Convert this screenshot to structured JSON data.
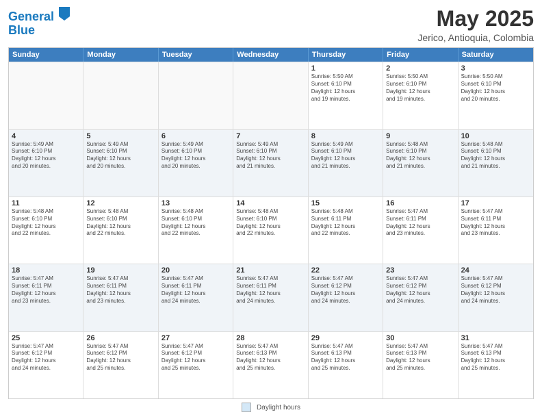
{
  "header": {
    "logo_line1": "General",
    "logo_line2": "Blue",
    "title": "May 2025",
    "subtitle": "Jerico, Antioquia, Colombia"
  },
  "days_of_week": [
    "Sunday",
    "Monday",
    "Tuesday",
    "Wednesday",
    "Thursday",
    "Friday",
    "Saturday"
  ],
  "footer": {
    "legend_label": "Daylight hours"
  },
  "weeks": [
    [
      {
        "day": "",
        "info": ""
      },
      {
        "day": "",
        "info": ""
      },
      {
        "day": "",
        "info": ""
      },
      {
        "day": "",
        "info": ""
      },
      {
        "day": "1",
        "info": "Sunrise: 5:50 AM\nSunset: 6:10 PM\nDaylight: 12 hours\nand 19 minutes."
      },
      {
        "day": "2",
        "info": "Sunrise: 5:50 AM\nSunset: 6:10 PM\nDaylight: 12 hours\nand 19 minutes."
      },
      {
        "day": "3",
        "info": "Sunrise: 5:50 AM\nSunset: 6:10 PM\nDaylight: 12 hours\nand 20 minutes."
      }
    ],
    [
      {
        "day": "4",
        "info": "Sunrise: 5:49 AM\nSunset: 6:10 PM\nDaylight: 12 hours\nand 20 minutes."
      },
      {
        "day": "5",
        "info": "Sunrise: 5:49 AM\nSunset: 6:10 PM\nDaylight: 12 hours\nand 20 minutes."
      },
      {
        "day": "6",
        "info": "Sunrise: 5:49 AM\nSunset: 6:10 PM\nDaylight: 12 hours\nand 20 minutes."
      },
      {
        "day": "7",
        "info": "Sunrise: 5:49 AM\nSunset: 6:10 PM\nDaylight: 12 hours\nand 21 minutes."
      },
      {
        "day": "8",
        "info": "Sunrise: 5:49 AM\nSunset: 6:10 PM\nDaylight: 12 hours\nand 21 minutes."
      },
      {
        "day": "9",
        "info": "Sunrise: 5:48 AM\nSunset: 6:10 PM\nDaylight: 12 hours\nand 21 minutes."
      },
      {
        "day": "10",
        "info": "Sunrise: 5:48 AM\nSunset: 6:10 PM\nDaylight: 12 hours\nand 21 minutes."
      }
    ],
    [
      {
        "day": "11",
        "info": "Sunrise: 5:48 AM\nSunset: 6:10 PM\nDaylight: 12 hours\nand 22 minutes."
      },
      {
        "day": "12",
        "info": "Sunrise: 5:48 AM\nSunset: 6:10 PM\nDaylight: 12 hours\nand 22 minutes."
      },
      {
        "day": "13",
        "info": "Sunrise: 5:48 AM\nSunset: 6:10 PM\nDaylight: 12 hours\nand 22 minutes."
      },
      {
        "day": "14",
        "info": "Sunrise: 5:48 AM\nSunset: 6:10 PM\nDaylight: 12 hours\nand 22 minutes."
      },
      {
        "day": "15",
        "info": "Sunrise: 5:48 AM\nSunset: 6:11 PM\nDaylight: 12 hours\nand 22 minutes."
      },
      {
        "day": "16",
        "info": "Sunrise: 5:47 AM\nSunset: 6:11 PM\nDaylight: 12 hours\nand 23 minutes."
      },
      {
        "day": "17",
        "info": "Sunrise: 5:47 AM\nSunset: 6:11 PM\nDaylight: 12 hours\nand 23 minutes."
      }
    ],
    [
      {
        "day": "18",
        "info": "Sunrise: 5:47 AM\nSunset: 6:11 PM\nDaylight: 12 hours\nand 23 minutes."
      },
      {
        "day": "19",
        "info": "Sunrise: 5:47 AM\nSunset: 6:11 PM\nDaylight: 12 hours\nand 23 minutes."
      },
      {
        "day": "20",
        "info": "Sunrise: 5:47 AM\nSunset: 6:11 PM\nDaylight: 12 hours\nand 24 minutes."
      },
      {
        "day": "21",
        "info": "Sunrise: 5:47 AM\nSunset: 6:11 PM\nDaylight: 12 hours\nand 24 minutes."
      },
      {
        "day": "22",
        "info": "Sunrise: 5:47 AM\nSunset: 6:12 PM\nDaylight: 12 hours\nand 24 minutes."
      },
      {
        "day": "23",
        "info": "Sunrise: 5:47 AM\nSunset: 6:12 PM\nDaylight: 12 hours\nand 24 minutes."
      },
      {
        "day": "24",
        "info": "Sunrise: 5:47 AM\nSunset: 6:12 PM\nDaylight: 12 hours\nand 24 minutes."
      }
    ],
    [
      {
        "day": "25",
        "info": "Sunrise: 5:47 AM\nSunset: 6:12 PM\nDaylight: 12 hours\nand 24 minutes."
      },
      {
        "day": "26",
        "info": "Sunrise: 5:47 AM\nSunset: 6:12 PM\nDaylight: 12 hours\nand 25 minutes."
      },
      {
        "day": "27",
        "info": "Sunrise: 5:47 AM\nSunset: 6:12 PM\nDaylight: 12 hours\nand 25 minutes."
      },
      {
        "day": "28",
        "info": "Sunrise: 5:47 AM\nSunset: 6:13 PM\nDaylight: 12 hours\nand 25 minutes."
      },
      {
        "day": "29",
        "info": "Sunrise: 5:47 AM\nSunset: 6:13 PM\nDaylight: 12 hours\nand 25 minutes."
      },
      {
        "day": "30",
        "info": "Sunrise: 5:47 AM\nSunset: 6:13 PM\nDaylight: 12 hours\nand 25 minutes."
      },
      {
        "day": "31",
        "info": "Sunrise: 5:47 AM\nSunset: 6:13 PM\nDaylight: 12 hours\nand 25 minutes."
      }
    ]
  ]
}
